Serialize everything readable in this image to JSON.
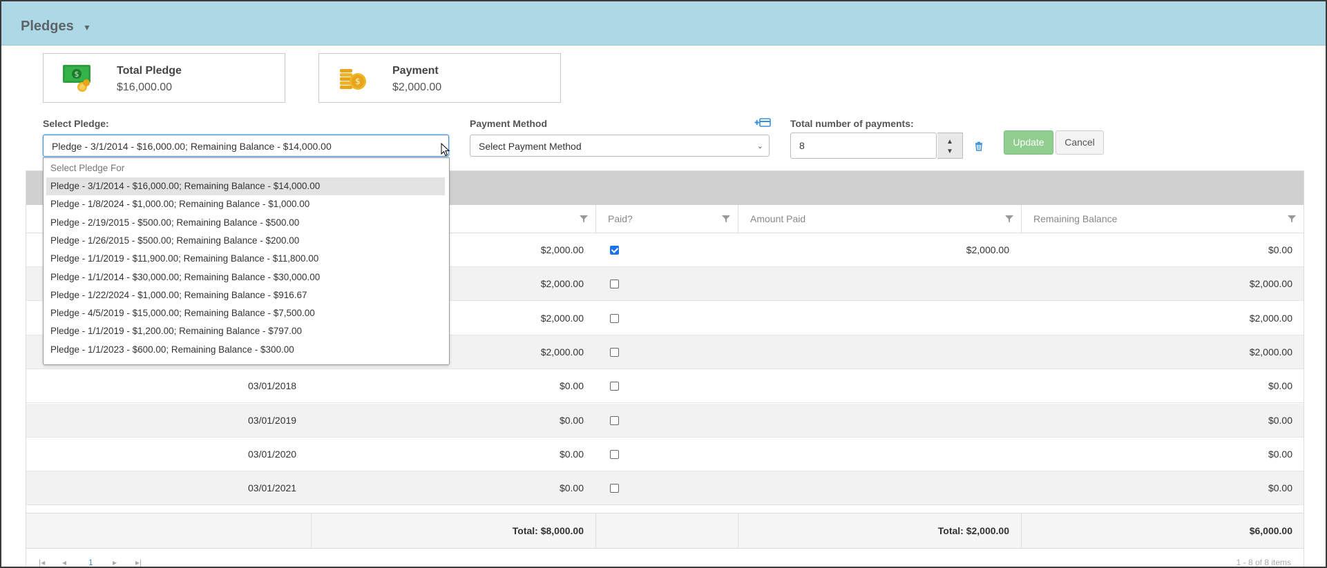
{
  "header": {
    "title": "Pledges"
  },
  "cards": {
    "total_pledge": {
      "label": "Total Pledge",
      "value": "$16,000.00"
    },
    "payment": {
      "label": "Payment",
      "value": "$2,000.00"
    }
  },
  "form": {
    "select_pledge_label": "Select Pledge:",
    "select_pledge_value": "Pledge - 3/1/2014 - $16,000.00; Remaining Balance - $14,000.00",
    "payment_method_label": "Payment Method",
    "payment_method_value": "Select Payment Method",
    "total_payments_label": "Total number of payments:",
    "total_payments_value": "8",
    "update_label": "Update",
    "cancel_label": "Cancel"
  },
  "dropdown": {
    "placeholder": "Select Pledge For",
    "options": [
      "Pledge - 3/1/2014 - $16,000.00; Remaining Balance - $14,000.00",
      "Pledge - 1/8/2024 - $1,000.00; Remaining Balance - $1,000.00",
      "Pledge - 2/19/2015 - $500.00; Remaining Balance - $500.00",
      "Pledge - 1/26/2015 - $500.00; Remaining Balance - $200.00",
      "Pledge - 1/1/2019 - $11,900.00; Remaining Balance - $11,800.00",
      "Pledge - 1/1/2014 - $30,000.00; Remaining Balance - $30,000.00",
      "Pledge - 1/22/2024 - $1,000.00; Remaining Balance - $916.67",
      "Pledge - 4/5/2019 - $15,000.00; Remaining Balance - $7,500.00",
      "Pledge - 1/1/2019 - $1,200.00; Remaining Balance - $797.00",
      "Pledge - 1/1/2023 - $600.00; Remaining Balance - $300.00"
    ]
  },
  "grid": {
    "columns": {
      "paid": "Paid?",
      "amount_paid": "Amount Paid",
      "remaining": "Remaining Balance"
    },
    "rows": [
      {
        "date": "",
        "amount": "$2,000.00",
        "paid": true,
        "amount_paid": "$2,000.00",
        "remaining": "$0.00"
      },
      {
        "date": "",
        "amount": "$2,000.00",
        "paid": false,
        "amount_paid": "",
        "remaining": "$2,000.00"
      },
      {
        "date": "",
        "amount": "$2,000.00",
        "paid": false,
        "amount_paid": "",
        "remaining": "$2,000.00"
      },
      {
        "date": "",
        "amount": "$2,000.00",
        "paid": false,
        "amount_paid": "",
        "remaining": "$2,000.00"
      },
      {
        "date": "03/01/2018",
        "amount": "$0.00",
        "paid": false,
        "amount_paid": "",
        "remaining": "$0.00"
      },
      {
        "date": "03/01/2019",
        "amount": "$0.00",
        "paid": false,
        "amount_paid": "",
        "remaining": "$0.00"
      },
      {
        "date": "03/01/2020",
        "amount": "$0.00",
        "paid": false,
        "amount_paid": "",
        "remaining": "$0.00"
      },
      {
        "date": "03/01/2021",
        "amount": "$0.00",
        "paid": false,
        "amount_paid": "",
        "remaining": "$0.00"
      }
    ],
    "totals": {
      "amount": "Total: $8,000.00",
      "amount_paid": "Total: $2,000.00",
      "remaining": "$6,000.00"
    },
    "pager": {
      "page": "1",
      "info": "1 - 8 of 8 items"
    }
  },
  "colors": {
    "header_bg": "#add8e6",
    "accent": "#4a90d9",
    "update_bg": "#8fce8f"
  }
}
